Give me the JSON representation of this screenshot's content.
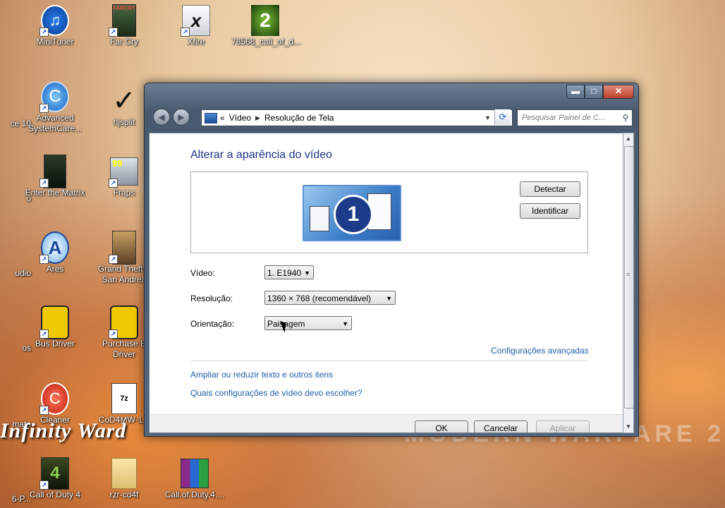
{
  "desktop": {
    "icons": [
      {
        "label": "MiniTuner",
        "icon": "headphones-icon"
      },
      {
        "label": "Far Cry",
        "icon": "farcry-icon"
      },
      {
        "label": "Xfire",
        "icon": "xfire-icon"
      },
      {
        "label": "78568_call_of_d...",
        "icon": "mw2-icon"
      },
      {
        "label": "ce 10",
        "icon": "app-icon"
      },
      {
        "label": "Advanced\nSystemCare...",
        "icon": "systemcare-icon"
      },
      {
        "label": "hjsplit",
        "icon": "checkmark-icon"
      },
      {
        "label": "o",
        "icon": "app-icon"
      },
      {
        "label": "Enter the Matrix",
        "icon": "matrix-icon"
      },
      {
        "label": "Fraps",
        "icon": "fraps-icon"
      },
      {
        "label": "udio",
        "icon": "app-icon"
      },
      {
        "label": "Ares",
        "icon": "ares-icon"
      },
      {
        "label": "Grand Theft A\nSan Andrea",
        "icon": "gta-icon"
      },
      {
        "label": "os",
        "icon": "app-icon"
      },
      {
        "label": "Bus Driver",
        "icon": "bus-icon"
      },
      {
        "label": "Purchase B\nDriver",
        "icon": "bus-icon"
      },
      {
        "label": "mate",
        "icon": "app-icon"
      },
      {
        "label": "Cleaner",
        "icon": "ccleaner-icon"
      },
      {
        "label": "CoD4MW-1.6",
        "icon": "7z-icon"
      },
      {
        "label": "6-P...",
        "icon": "app-icon"
      },
      {
        "label": "Call of Duty 4",
        "icon": "cod4-icon"
      },
      {
        "label": "rzr-cd4f",
        "icon": "folder-icon"
      },
      {
        "label": "Call.of.Duty.4....",
        "icon": "winrar-icon"
      }
    ],
    "wallpaper_text_left": "Infinity Ward",
    "wallpaper_text_right": "MODERN WARFARE 2"
  },
  "window": {
    "controls": {
      "minimize": "▬",
      "maximize": "□",
      "close": "✕"
    },
    "address": {
      "prefix": "«",
      "crumb1": "Vídeo",
      "crumb2": "Resolução de Tela"
    },
    "search_placeholder": "Pesquisar Painel de C...",
    "heading": "Alterar a aparência do vídeo",
    "monitor_number": "1",
    "detect_button": "Detectar",
    "identify_button": "Identificar",
    "fields": {
      "video_label": "Vídeo:",
      "video_value": "1. E1940",
      "resolution_label": "Resolução:",
      "resolution_value": "1360 × 768 (recomendável)",
      "orientation_label": "Orientação:",
      "orientation_value": "Paisagem"
    },
    "advanced_link": "Configurações avançadas",
    "link1": "Ampliar ou reduzir texto e outros itens",
    "link2": "Quais configurações de vídeo devo escolher?",
    "ok_button": "OK",
    "cancel_button": "Cancelar",
    "apply_button": "Aplicar"
  }
}
